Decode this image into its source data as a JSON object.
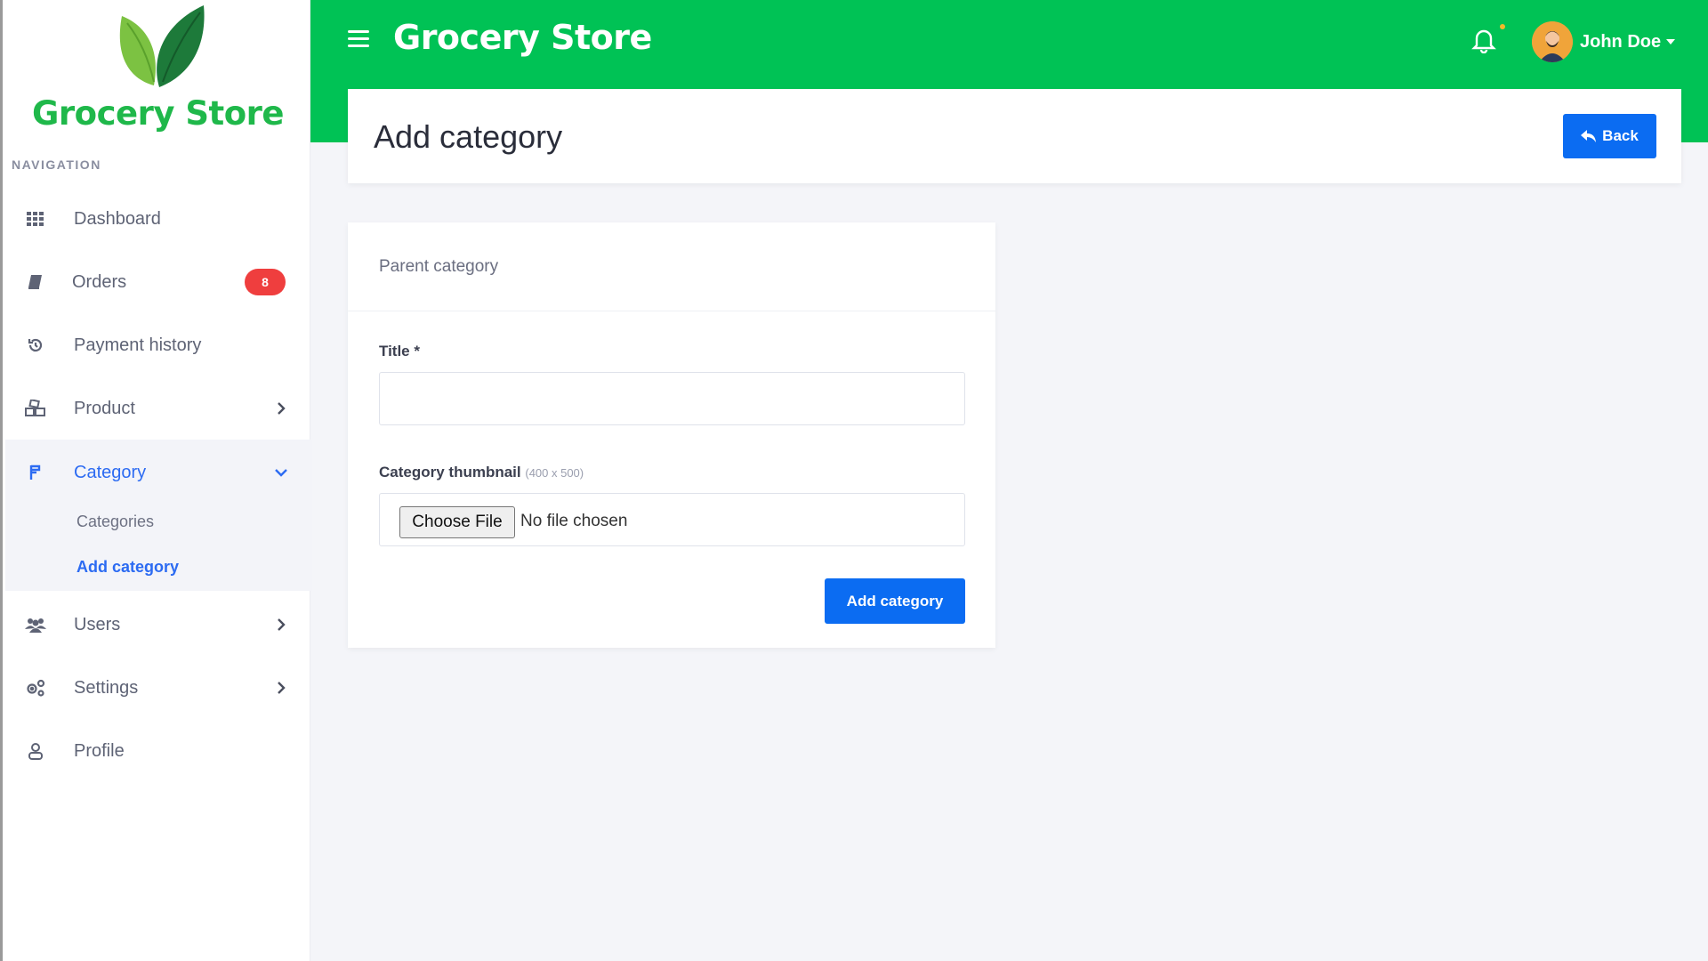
{
  "brand": {
    "name": "Grocery Store",
    "logo_icon": "leaf-logo-icon",
    "color": "#1fb84a"
  },
  "sidebar": {
    "heading": "NAVIGATION",
    "items": [
      {
        "label": "Dashboard",
        "icon": "grid-icon"
      },
      {
        "label": "Orders",
        "icon": "book-icon",
        "badge": "8"
      },
      {
        "label": "Payment history",
        "icon": "history-icon"
      },
      {
        "label": "Product",
        "icon": "boxes-icon"
      },
      {
        "label": "Category",
        "icon": "category-icon",
        "expanded": true
      },
      {
        "label": "Users",
        "icon": "users-icon"
      },
      {
        "label": "Settings",
        "icon": "cogs-icon"
      },
      {
        "label": "Profile",
        "icon": "user-icon"
      }
    ],
    "category_sub": [
      {
        "label": "Categories"
      },
      {
        "label": "Add category",
        "active": true
      }
    ]
  },
  "topbar": {
    "title": "Grocery Store",
    "bg_color": "#00c255",
    "user_name": "John Doe"
  },
  "page": {
    "title": "Add category",
    "back_label": "Back"
  },
  "form": {
    "card_title": "Parent category",
    "title_label": "Title *",
    "title_value": "",
    "thumbnail_label": "Category thumbnail",
    "thumbnail_hint": "(400 x 500)",
    "choose_file_label": "Choose File",
    "file_status": "No file chosen",
    "submit_label": "Add category"
  },
  "colors": {
    "accent": "#0b6cf2",
    "badge": "#ef3e3e"
  }
}
